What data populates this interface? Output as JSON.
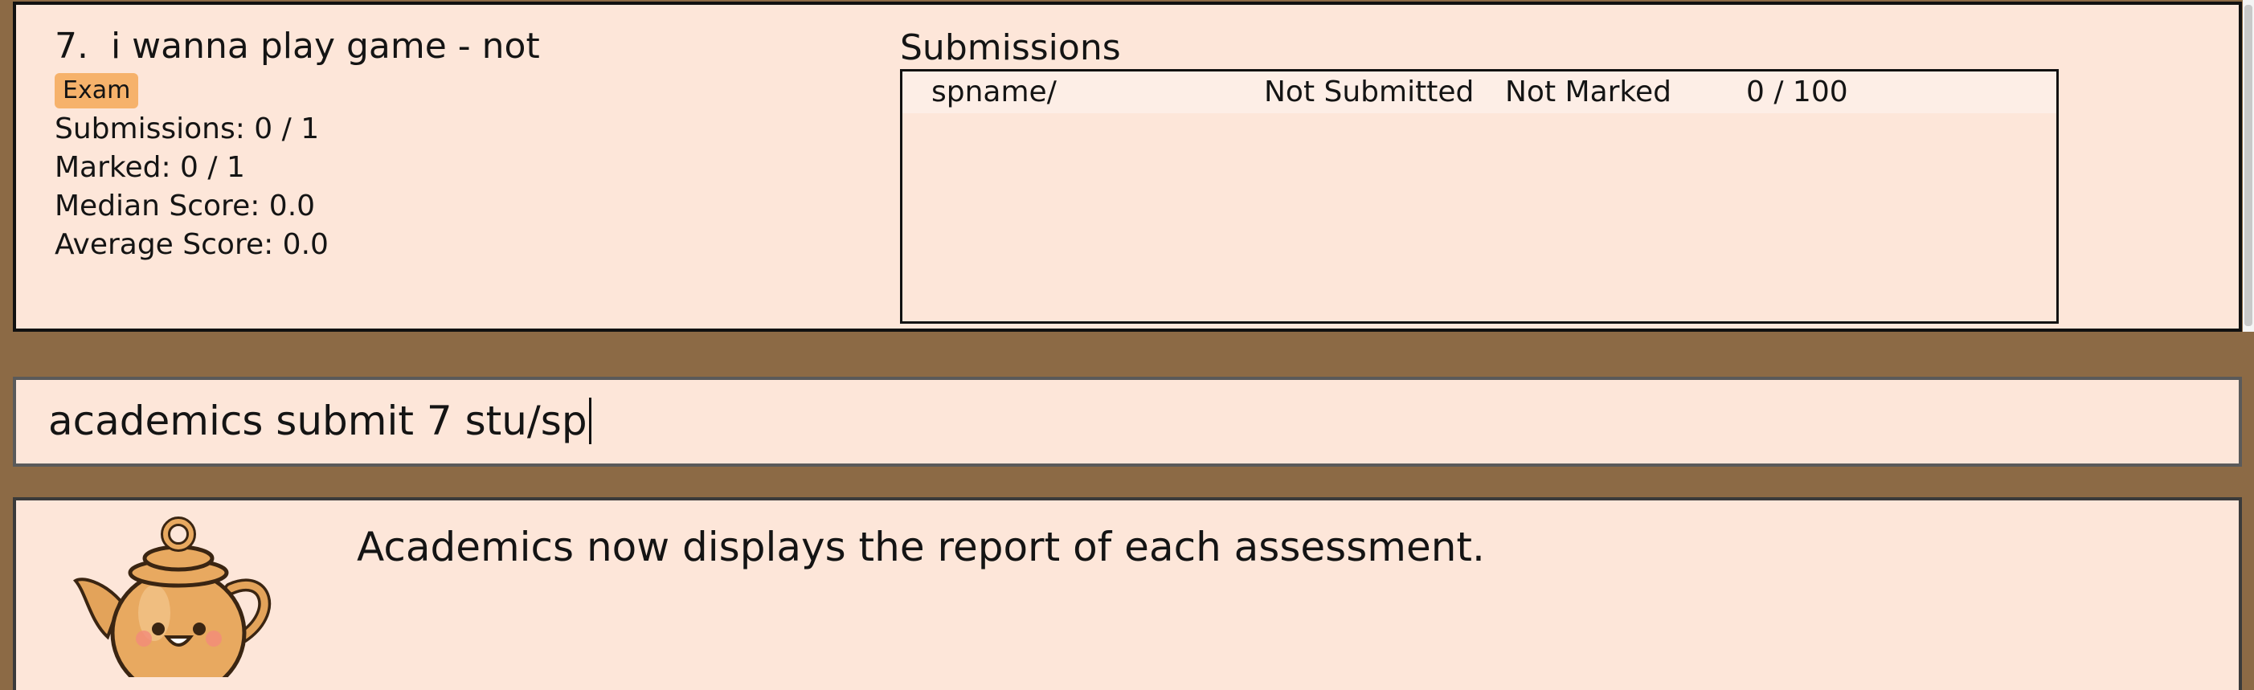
{
  "assessment": {
    "index": "7.",
    "title": "i wanna play game - not",
    "badge": "Exam",
    "submissions": "Submissions: 0 / 1",
    "marked": "Marked: 0 / 1",
    "median": "Median Score: 0.0",
    "average": "Average Score: 0.0"
  },
  "submissions_panel": {
    "heading": "Submissions",
    "rows": [
      {
        "name": "spname/",
        "submission_status": "Not Submitted",
        "marking_status": "Not Marked",
        "score": "0 / 100"
      }
    ]
  },
  "command_box": {
    "value": "academics submit 7 stu/sp"
  },
  "result_display": {
    "message": "Academics now displays the report of each assessment."
  },
  "mascot": {
    "icon": "teapot-mascot-icon"
  },
  "colors": {
    "background": "#8c6a45",
    "panel": "#fde6d9",
    "badge": "#f6b26b"
  }
}
